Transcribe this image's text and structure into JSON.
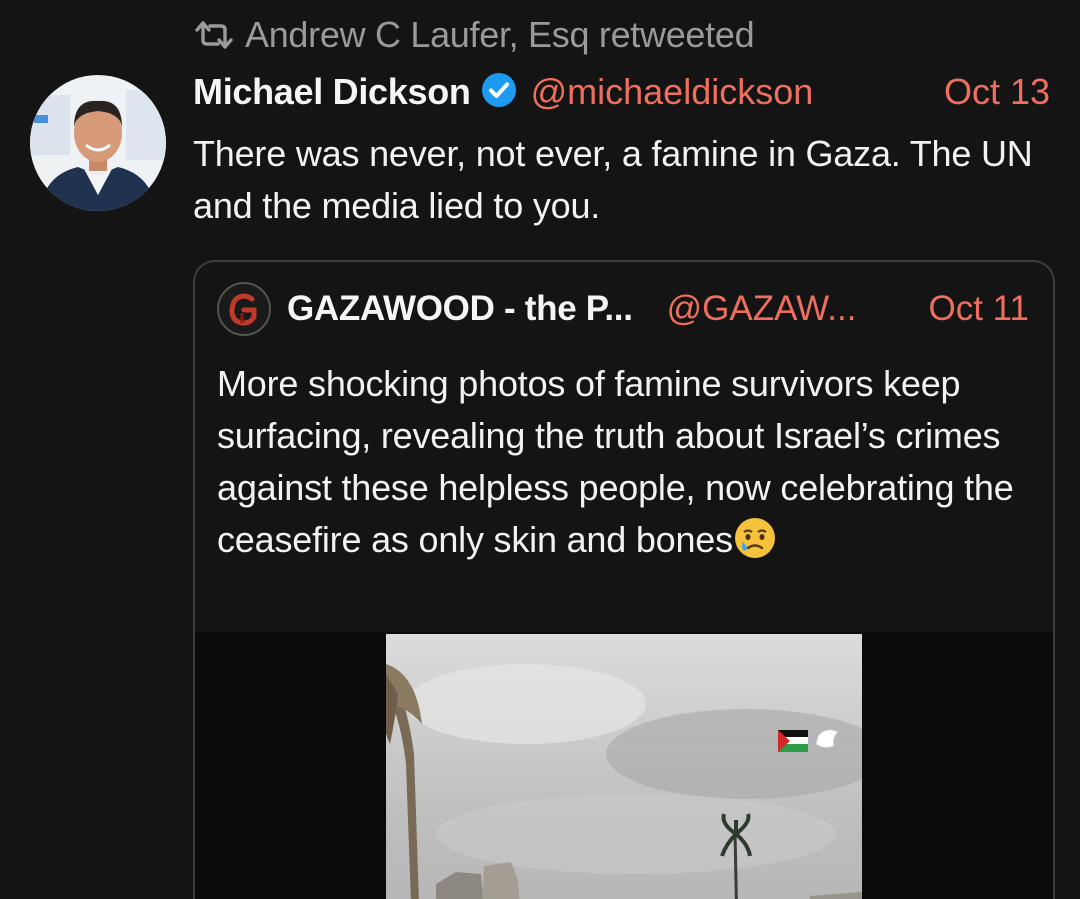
{
  "retweet": {
    "text": "Andrew C Laufer, Esq retweeted",
    "icon": "retweet-icon"
  },
  "tweet": {
    "author_name": "Michael Dickson",
    "verified": true,
    "handle": "@michaeldickson",
    "date": "Oct 13",
    "text": "There was never, not ever, a famine in Gaza. The UN and the media lied to you."
  },
  "quote": {
    "author_name": "GAZAWOOD - the P...",
    "handle": "@GAZAW...",
    "date": "Oct 11",
    "text": "More shocking photos of famine survivors keep surfacing, revealing the truth about Israel’s crimes against these helpless people, now celebrating the ceasefire as only skin and bones",
    "emoji": "crying-face-emoji"
  },
  "colors": {
    "background": "#141414",
    "accent": "#ef6f5e",
    "verified_blue": "#1d9bf0",
    "muted_text": "#9a9a9a"
  }
}
